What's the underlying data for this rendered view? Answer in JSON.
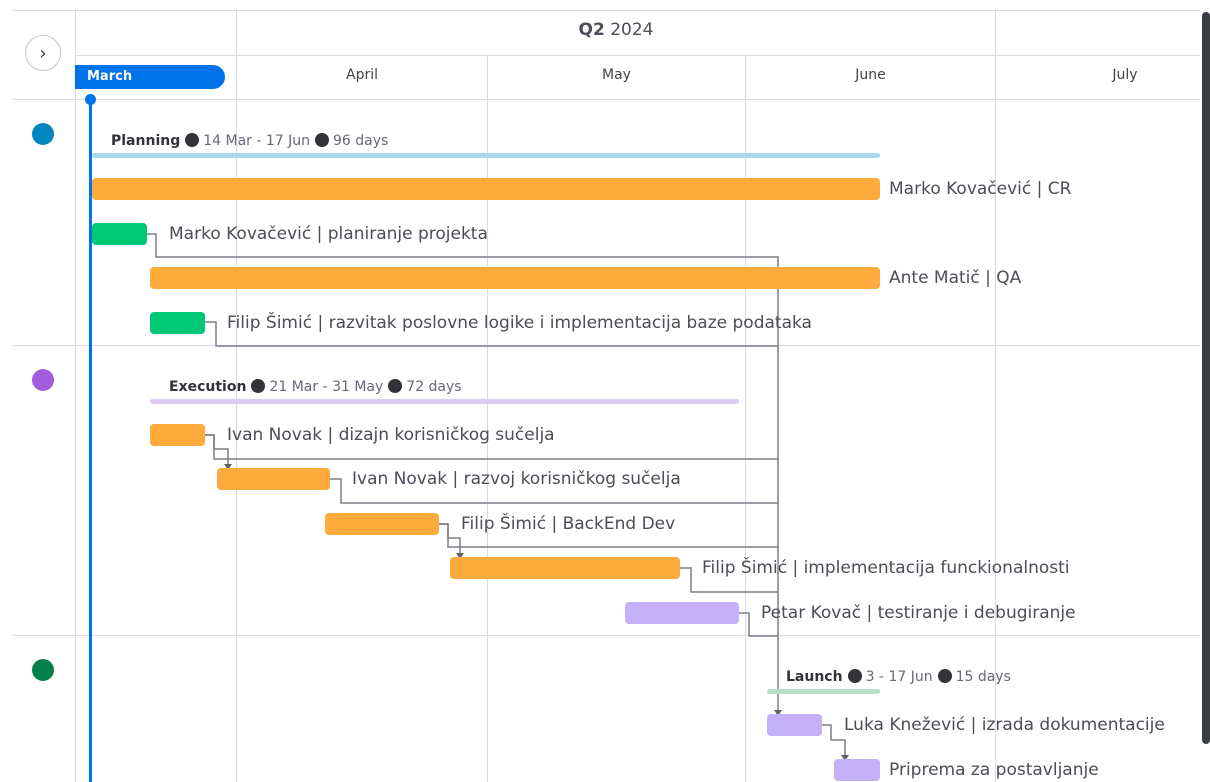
{
  "timeline": {
    "quarter_bold": "Q2",
    "quarter_year": "2024",
    "current_month": "March",
    "months": [
      "April",
      "May",
      "June",
      "July"
    ],
    "nav_icon": "chevron-right-icon"
  },
  "groups": [
    {
      "name": "Planning",
      "dates": "14 Mar - 17 Jun",
      "duration": "96 days",
      "color": "#0086c0",
      "line_color": "#a9d8e8",
      "items": [
        {
          "label": "Marko Kovačević | CR",
          "color": "#fdab3d"
        },
        {
          "label": "Marko Kovačević | planiranje projekta",
          "color": "#00c875"
        },
        {
          "label": "Ante Matič | QA",
          "color": "#fdab3d"
        },
        {
          "label": "Filip Šimić | razvitak poslovne logike i implementacija baze podataka",
          "color": "#00c875"
        }
      ]
    },
    {
      "name": "Execution",
      "dates": "21 Mar - 31 May",
      "duration": "72 days",
      "color": "#a25ddc",
      "line_color": "#dccbf2",
      "items": [
        {
          "label": "Ivan Novak | dizajn korisničkog sučelja",
          "color": "#fdab3d"
        },
        {
          "label": "Ivan Novak | razvoj korisničkog sučelja",
          "color": "#fdab3d"
        },
        {
          "label": "Filip Šimić | BackEnd Dev",
          "color": "#fdab3d"
        },
        {
          "label": "Filip Šimić | implementacija funckionalnosti",
          "color": "#fdab3d"
        },
        {
          "label": "Petar Kovač | testiranje i debugiranje",
          "color": "#c4b1f8"
        }
      ]
    },
    {
      "name": "Launch",
      "dates": "3 - 17 Jun",
      "duration": "15 days",
      "color": "#037f4c",
      "line_color": "#b6ddc8",
      "items": [
        {
          "label": "Luka Knežević | izrada dokumentacije",
          "color": "#c4b1f8"
        },
        {
          "label": "Priprema za postavljanje",
          "color": "#c4b1f8"
        }
      ]
    }
  ]
}
